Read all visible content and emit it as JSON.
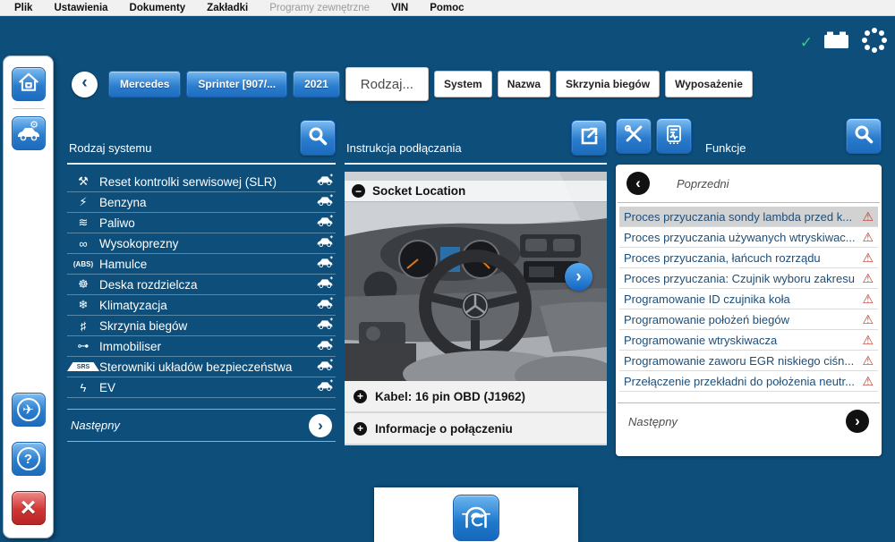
{
  "menu_bar": {
    "items": [
      {
        "label": "Plik",
        "enabled": true
      },
      {
        "label": "Ustawienia",
        "enabled": true
      },
      {
        "label": "Dokumenty",
        "enabled": true
      },
      {
        "label": "Zakładki",
        "enabled": true
      },
      {
        "label": "Programy zewnętrzne",
        "enabled": false
      },
      {
        "label": "VIN",
        "enabled": true
      },
      {
        "label": "Pomoc",
        "enabled": true
      }
    ]
  },
  "glyphs": {
    "check": "✓",
    "chevron_left": "‹",
    "chevron_right": "›",
    "minus": "−",
    "plus": "+",
    "warning": "⚠",
    "plane": "✈",
    "question": "?",
    "close": "×"
  },
  "breadcrumb": {
    "steps": [
      {
        "label": "Mercedes",
        "type": "blue"
      },
      {
        "label": "Sprinter [907/...",
        "type": "blue"
      },
      {
        "label": "2021",
        "type": "blue"
      },
      {
        "label": "Rodzaj...",
        "type": "active"
      },
      {
        "label": "System",
        "type": "white"
      },
      {
        "label": "Nazwa",
        "type": "white"
      },
      {
        "label": "Skrzynia biegów",
        "type": "white"
      },
      {
        "label": "Wyposażenie",
        "type": "white"
      }
    ]
  },
  "system_panel": {
    "title": "Rodzaj systemu",
    "next_label": "Następny",
    "items": [
      {
        "icon": "wrench-icon",
        "glyph": "⚒",
        "label": "Reset kontrolki serwisowej (SLR)"
      },
      {
        "icon": "ignition-spark-icon",
        "glyph": "⚡",
        "label": "Benzyna"
      },
      {
        "icon": "fuel-injection-icon",
        "glyph": "≋",
        "label": "Paliwo"
      },
      {
        "icon": "glow-plug-icon",
        "glyph": "∞",
        "label": "Wysokoprezny"
      },
      {
        "icon": "abs-icon",
        "glyph": "(ABS)",
        "label": "Hamulce"
      },
      {
        "icon": "dashboard-icon",
        "glyph": "☸",
        "label": "Deska rozdzielcza"
      },
      {
        "icon": "climate-icon",
        "glyph": "❄",
        "label": "Klimatyzacja"
      },
      {
        "icon": "gearshift-icon",
        "glyph": "♯",
        "label": "Skrzynia biegów"
      },
      {
        "icon": "immobiliser-key-icon",
        "glyph": "⊶",
        "label": "Immobiliser"
      },
      {
        "icon": "srs-icon",
        "glyph": "SRS",
        "label": "Sterowniki układów bezpieczeństwa"
      },
      {
        "icon": "ev-plug-icon",
        "glyph": "ϟ",
        "label": "EV"
      }
    ]
  },
  "connection_panel": {
    "title": "Instrukcja podłączania",
    "image_caption": "Socket Location",
    "cable_label": "Kabel: 16 pin OBD (J1962)",
    "info_label": "Informacje o połączeniu"
  },
  "functions_panel": {
    "title": "Funkcje",
    "previous_label": "Poprzedni",
    "next_label": "Następny",
    "items": [
      {
        "label": "Proces przyuczania sondy lambda przed k...",
        "selected": true
      },
      {
        "label": "Proces przyuczania używanych wtryskiwac...",
        "selected": false
      },
      {
        "label": "Proces przyuczania, łańcuch rozrządu",
        "selected": false
      },
      {
        "label": "Proces przyuczania: Czujnik wyboru zakresu",
        "selected": false
      },
      {
        "label": "Programowanie ID czujnika koła",
        "selected": false
      },
      {
        "label": "Programowanie położeń biegów",
        "selected": false
      },
      {
        "label": "Programowanie wtryskiwacza",
        "selected": false
      },
      {
        "label": "Programowanie zaworu EGR niskiego ciśn...",
        "selected": false
      },
      {
        "label": "Przełączenie przekładni do położenia neutr...",
        "selected": false
      }
    ]
  },
  "colors": {
    "background": "#0d4e7a",
    "accent_blue": "#2a7ccd",
    "selected_row": "#d2d2d2",
    "warning_red": "#c0392b",
    "check_green": "#35d07f"
  }
}
